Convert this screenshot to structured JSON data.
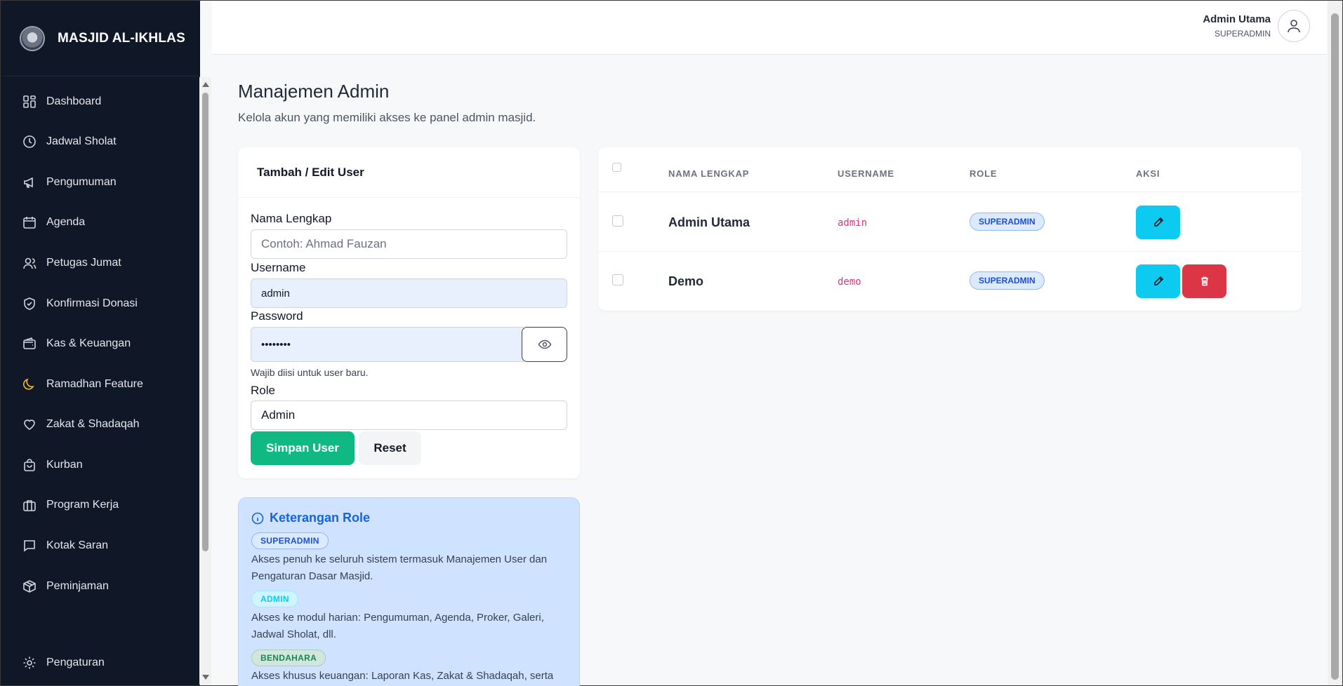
{
  "sidebar": {
    "brand": "MASJID AL-IKHLAS",
    "items": [
      {
        "label": "Dashboard",
        "icon": "dashboard-icon"
      },
      {
        "label": "Jadwal Sholat",
        "icon": "clock-icon"
      },
      {
        "label": "Pengumuman",
        "icon": "megaphone-icon"
      },
      {
        "label": "Agenda",
        "icon": "calendar-icon"
      },
      {
        "label": "Petugas Jumat",
        "icon": "users-icon"
      },
      {
        "label": "Konfirmasi Donasi",
        "icon": "shield-check-icon"
      },
      {
        "label": "Kas & Keuangan",
        "icon": "wallet-icon"
      },
      {
        "label": "Ramadhan Feature",
        "icon": "moon-icon"
      },
      {
        "label": "Zakat & Shadaqah",
        "icon": "heart-icon"
      },
      {
        "label": "Kurban",
        "icon": "bag-icon"
      },
      {
        "label": "Program Kerja",
        "icon": "briefcase-icon"
      },
      {
        "label": "Kotak Saran",
        "icon": "chat-icon"
      },
      {
        "label": "Peminjaman",
        "icon": "box-icon"
      },
      {
        "label": "Pengaturan",
        "icon": "gear-icon"
      }
    ]
  },
  "topbar": {
    "user_name": "Admin Utama",
    "user_role": "SUPERADMIN"
  },
  "page": {
    "title": "Manajemen Admin",
    "subtitle": "Kelola akun yang memiliki akses ke panel admin masjid."
  },
  "form": {
    "title": "Tambah / Edit User",
    "name_label": "Nama Lengkap",
    "name_placeholder": "Contoh: Ahmad Fauzan",
    "username_label": "Username",
    "username_value": "admin",
    "password_label": "Password",
    "password_value": "••••••••",
    "password_hint": "Wajib diisi untuk user baru.",
    "role_label": "Role",
    "role_value": "Admin",
    "save_label": "Simpan User",
    "reset_label": "Reset"
  },
  "role_info": {
    "title": "Keterangan Role",
    "roles": [
      {
        "badge": "SUPERADMIN",
        "desc": "Akses penuh ke seluruh sistem termasuk Manajemen User dan Pengaturan Dasar Masjid."
      },
      {
        "badge": "ADMIN",
        "desc": "Akses ke modul harian: Pengumuman, Agenda, Proker, Galeri, Jadwal Sholat, dll."
      },
      {
        "badge": "BENDAHARA",
        "desc": "Akses khusus keuangan: Laporan Kas, Zakat & Shadaqah, serta"
      }
    ]
  },
  "table": {
    "headers": [
      "NAMA LENGKAP",
      "USERNAME",
      "ROLE",
      "AKSI"
    ],
    "rows": [
      {
        "name": "Admin Utama",
        "username": "admin",
        "role": "SUPERADMIN",
        "deletable": false
      },
      {
        "name": "Demo",
        "username": "demo",
        "role": "SUPERADMIN",
        "deletable": true
      }
    ]
  },
  "colors": {
    "sidebar_bg": "#101828",
    "primary_green": "#10b981",
    "edit_cyan": "#0dcaf0",
    "delete_red": "#dc3545",
    "info_bg": "#cfe2ff"
  }
}
